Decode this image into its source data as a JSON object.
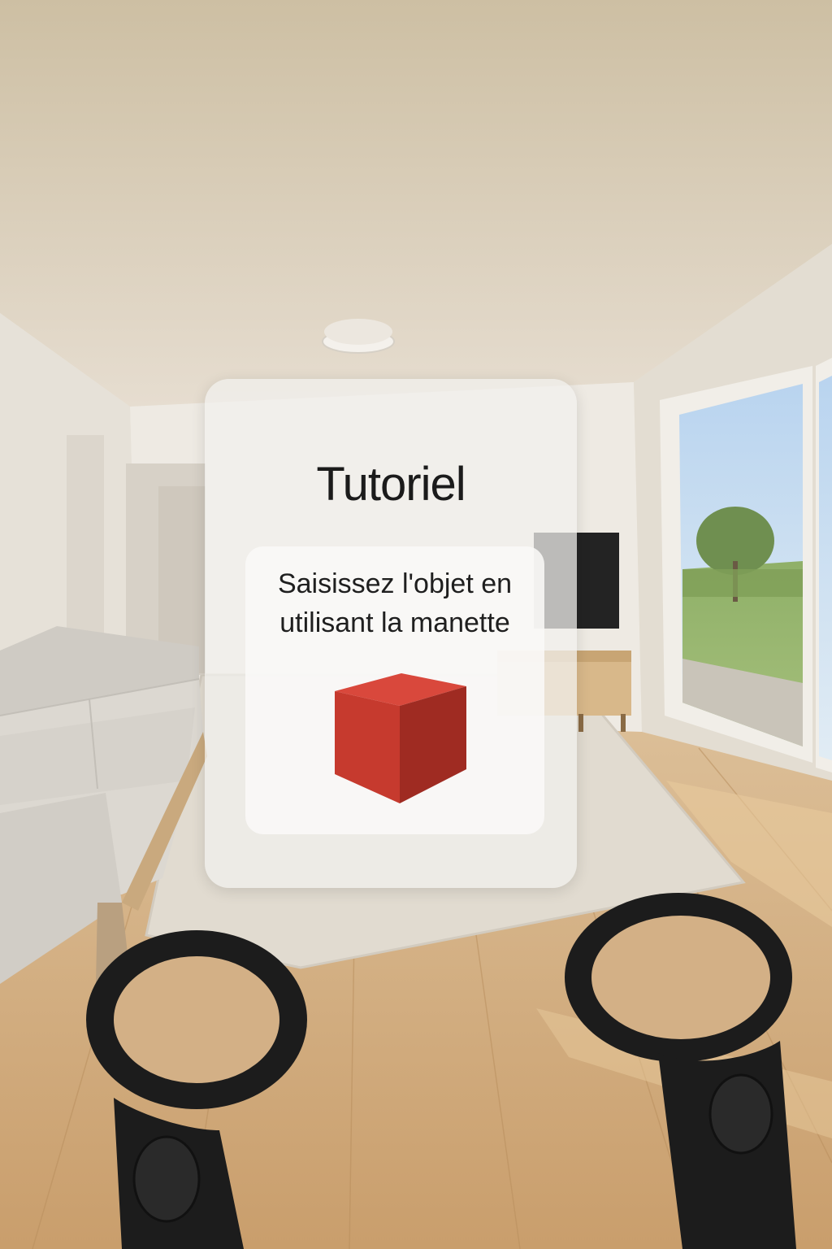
{
  "tutorial_panel": {
    "title": "Tutoriel",
    "instruction": "Saisissez l'objet en utilisant la manette",
    "object_icon": "red-cube-icon"
  },
  "colors": {
    "cube_top": "#d9483c",
    "cube_left": "#c63a2e",
    "cube_right": "#9f2b22",
    "controller": "#1c1c1c",
    "floor": "#d1aa7b",
    "wall": "#e9e4da"
  }
}
